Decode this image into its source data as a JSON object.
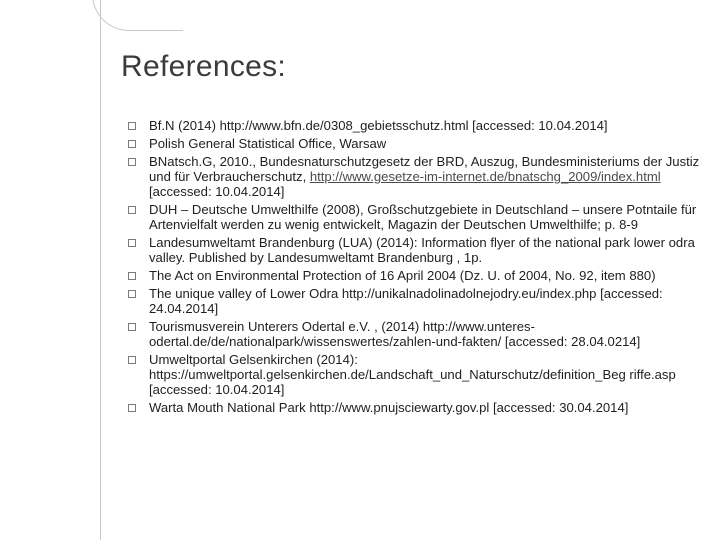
{
  "slide": {
    "title": "References:"
  },
  "references": [
    {
      "text": "Bf.N (2014) http://www.bfn.de/0308_gebietsschutz.html [accessed: 10.04.2014]"
    },
    {
      "text": " Polish General Statistical Office,  Warsaw"
    },
    {
      "text": "BNatsch.G, 2010.,  Bundesnaturschutzgesetz der BRD,  Auszug, Bundesministeriums der Justiz und für Verbraucherschutz, ",
      "link": "http://www.gesetze-im-internet.de/bnatschg_2009/index.html",
      "tail": " [accessed: 10.04.2014]"
    },
    {
      "text": "DUH – Deutsche Umwelthilfe (2008),  Großschutzgebiete in Deutschland – unsere Potntaile für Artenvielfalt werden zu wenig entwickelt, Magazin der Deutschen Umwelthilfe;  p. 8-9"
    },
    {
      "text": "Landesumweltamt Brandenburg (LUA) (2014):  Information flyer of the national park lower odra valley. Published by Landesumweltamt Brandenburg , 1p."
    },
    {
      "text": "The Act on Environmental Protection of 16 April 2004 (Dz. U. of 2004, No. 92, item 880)"
    },
    {
      "text": "The unique valley of Lower Odra http://unikalnadolinadolnejodry.eu/index.php [accessed: 24.04.2014]"
    },
    {
      "text": "Tourismusverein Unterers Odertal e.V. ,  (2014)  http://www.unteres-odertal.de/de/nationalpark/wissenswertes/zahlen-und-fakten/ [accessed: 28.04.0214]"
    },
    {
      "text": "Umweltportal Gelsenkirchen (2014): https://umweltportal.gelsenkirchen.de/Landschaft_und_Naturschutz/definition_Beg riffe.asp [accessed: 10.04.2014]"
    },
    {
      "text": "Warta Mouth National Park http://www.pnujsciewarty.gov.pl [accessed: 30.04.2014]"
    }
  ]
}
